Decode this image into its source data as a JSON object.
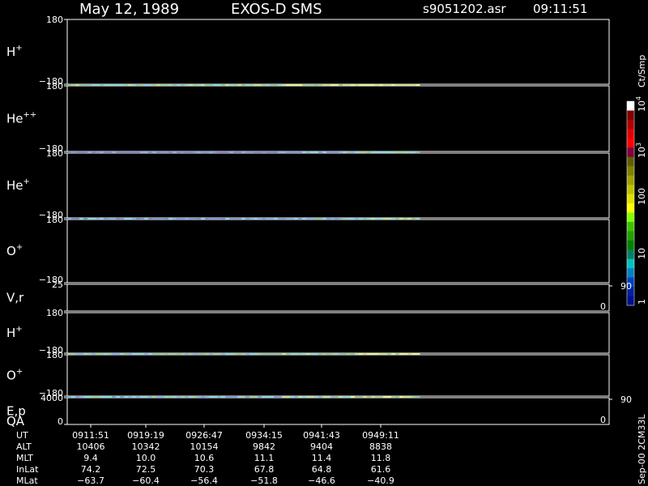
{
  "header": {
    "date": "May 12, 1989",
    "instrument": "EXOS-D SMS",
    "file": "s9051202.asr",
    "time": "09:11:51"
  },
  "chart_data": {
    "type": "heatmap",
    "panels": [
      {
        "label": "H",
        "sup": "+",
        "ymax": "180",
        "ymin": "−180",
        "palette": [
          3,
          4,
          5,
          6
        ],
        "trend": [
          0.3,
          0.1
        ]
      },
      {
        "label": "He",
        "sup": "++",
        "ymax": "180",
        "ymin": "−180",
        "palette": [
          0,
          0,
          1,
          2
        ],
        "trend": [
          0.3,
          0.12
        ]
      },
      {
        "label": "He",
        "sup": "+",
        "ymax": "180",
        "ymin": "−180",
        "palette": [
          0,
          1,
          2,
          3
        ],
        "trend": [
          0.3,
          0.12
        ]
      },
      {
        "label": "O",
        "sup": "+",
        "ymax": "180",
        "ymin": "−180",
        "palette": [
          0,
          1,
          2,
          4
        ],
        "trend": [
          0.3,
          0.15
        ]
      },
      {
        "label": "V,r",
        "sup": "",
        "ymax": "25",
        "ymin": "",
        "line": true
      },
      {
        "label": "H",
        "sup": "+",
        "ymax": "180",
        "ymin": "−180",
        "palette": [
          2,
          3,
          4,
          5
        ],
        "trend": [
          0.45,
          0.5
        ]
      },
      {
        "label": "O",
        "sup": "+",
        "ymax": "180",
        "ymin": "−180",
        "palette": [
          1,
          2,
          3,
          5
        ],
        "trend": [
          0.35,
          0.5
        ]
      },
      {
        "label": "E,p",
        "sup": "",
        "ymax": "4000",
        "ymin": "0",
        "line": true,
        "sublabel": "QA"
      }
    ],
    "right_ticks": [
      {
        "panel": 4,
        "top": "90",
        "bottom": "0"
      },
      {
        "panel": 7,
        "top": "90",
        "bottom": "0"
      }
    ],
    "colorbar": {
      "units": "Ct/Smp",
      "ticks": [
        "1",
        "10",
        "100",
        "10",
        "10"
      ],
      "tick_sups": [
        "",
        "",
        "",
        "3",
        "4"
      ],
      "colors": [
        "#ffffff",
        "#800000",
        "#b00000",
        "#e00000",
        "#ff0000",
        "#800040",
        "#606000",
        "#808000",
        "#a0a000",
        "#c0c000",
        "#e0e000",
        "#ffff00",
        "#80ff00",
        "#40c000",
        "#20a000",
        "#008000",
        "#008060",
        "#00c0c0",
        "#0080c0",
        "#0040c0",
        "#0020a0",
        "#001090"
      ]
    },
    "time_axis": {
      "rows": [
        "UT",
        "ALT",
        "MLT",
        "InLat",
        "MLat"
      ],
      "ut": [
        "0911:51",
        "0919:19",
        "0926:47",
        "0934:15",
        "0941:43",
        "0949:11"
      ],
      "alt": [
        "10406",
        "10342",
        "10154",
        "9842",
        "9404",
        "8838"
      ],
      "mlt": [
        "9.4",
        "10.0",
        "10.6",
        "11.1",
        "11.4",
        "11.8"
      ],
      "inlat": [
        "74.2",
        "72.5",
        "70.3",
        "67.8",
        "64.8",
        "61.6"
      ],
      "mlat": [
        "−63.7",
        "−60.4",
        "−56.4",
        "−51.8",
        "−46.6",
        "−40.9"
      ]
    },
    "footer_note": "Sep-00 2CM33L"
  }
}
